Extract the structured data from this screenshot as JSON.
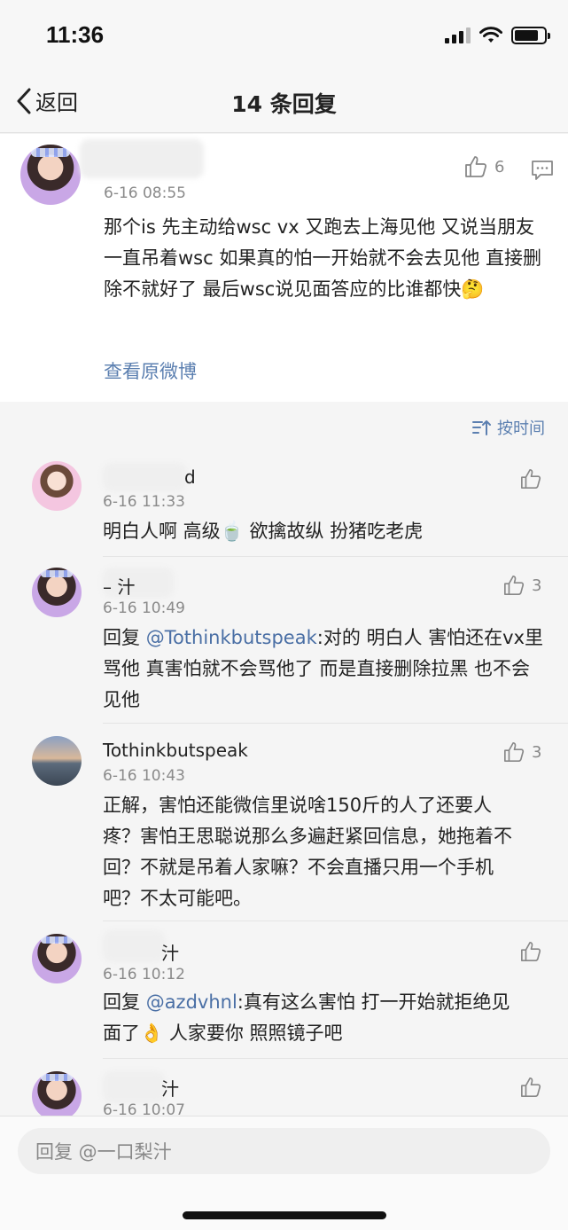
{
  "status_bar": {
    "time": "11:36"
  },
  "nav": {
    "back_label": "返回",
    "title": "14 条回复"
  },
  "root_comment": {
    "time": "6-16 08:55",
    "like_count": "6",
    "text": "那个is 先主动给wsc vx 又跑去上海见他 又说当朋友 一直吊着wsc 如果真的怕一开始就不会去见他 直接删除不就好了 最后wsc说见面答应的比谁都快🤔",
    "view_original": "查看原微博"
  },
  "sort": {
    "label": "按时间"
  },
  "replies": [
    {
      "name": "d",
      "time": "6-16 11:33",
      "like_count": "",
      "text": "明白人啊 高级🍵 欲擒故纵 扮猪吃老虎"
    },
    {
      "name": "– 汁",
      "time": "6-16 10:49",
      "like_count": "3",
      "mention": "@Tothinkbutspeak",
      "prefix": "回复 ",
      "text": ":对的 明白人 害怕还在vx里骂他 真害怕就不会骂他了 而是直接删除拉黑 也不会见他"
    },
    {
      "name": "Tothinkbutspeak",
      "time": "6-16 10:43",
      "like_count": "3",
      "text": "正解，害怕还能微信里说啥150斤的人了还要人疼？害怕王思聪说那么多遍赶紧回信息，她拖着不回？不就是吊着人家嘛？不会直播只用一个手机吧？不太可能吧。"
    },
    {
      "name": "汁",
      "time": "6-16 10:12",
      "like_count": "",
      "mention": "@azdvhnl",
      "prefix": "回复 ",
      "text": ":真有这么害怕 打一开始就拒绝见面了👌 人家要你 照照镜子吧"
    },
    {
      "name": "汁",
      "time": "6-16 10:07",
      "like_count": ""
    }
  ],
  "reply_box": {
    "placeholder": "回复 @一口梨汁"
  }
}
